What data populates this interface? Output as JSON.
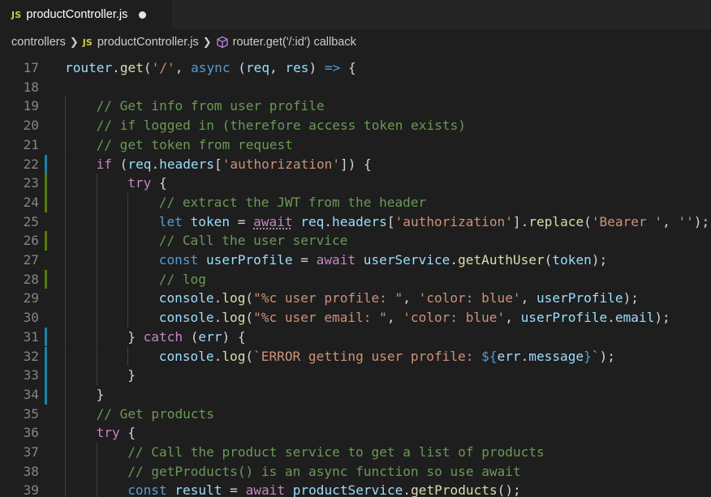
{
  "tab": {
    "badge": "JS",
    "label": "productController.js",
    "dirty": true
  },
  "breadcrumb": {
    "items": [
      {
        "label": "controllers"
      },
      {
        "label": "productController.js",
        "badge": "JS"
      },
      {
        "label": "router.get('/:id') callback",
        "icon": "symbol-method-icon"
      }
    ],
    "separator": "chevron-right-icon"
  },
  "colors": {
    "keyword_blue": "#569cd6",
    "control_purple": "#c586c0",
    "function_yellow": "#dcdcaa",
    "variable_blue": "#9cdcfe",
    "string_orange": "#ce9178",
    "comment_green": "#6a9955",
    "default_text": "#d4d4d4",
    "gutter_added": "#587c0c",
    "gutter_modified": "#1b81a8",
    "js_badge": "#cbcb41"
  },
  "code": {
    "lines": [
      {
        "n": 17,
        "indent": 0,
        "mark": "",
        "tokens": [
          [
            "router",
            "var"
          ],
          [
            ".",
            ""
          ],
          [
            "get",
            "fn"
          ],
          [
            "(",
            ""
          ],
          [
            "'/'",
            "str"
          ],
          [
            ", ",
            ""
          ],
          [
            "async",
            "kw"
          ],
          [
            " (",
            ""
          ],
          [
            "req",
            "var"
          ],
          [
            ", ",
            ""
          ],
          [
            "res",
            "var"
          ],
          [
            ") ",
            ""
          ],
          [
            "=>",
            "kw"
          ],
          [
            " {",
            ""
          ]
        ]
      },
      {
        "n": 18,
        "indent": 0,
        "mark": "",
        "tokens": []
      },
      {
        "n": 19,
        "indent": 1,
        "mark": "",
        "tokens": [
          [
            "// Get info from user profile",
            "comment"
          ]
        ]
      },
      {
        "n": 20,
        "indent": 1,
        "mark": "",
        "tokens": [
          [
            "// if logged in (therefore access token exists)",
            "comment"
          ]
        ]
      },
      {
        "n": 21,
        "indent": 1,
        "mark": "",
        "tokens": [
          [
            "// get token from request",
            "comment"
          ]
        ]
      },
      {
        "n": 22,
        "indent": 1,
        "mark": "blue",
        "tokens": [
          [
            "if",
            "ctrl"
          ],
          [
            " (",
            ""
          ],
          [
            "req",
            "var"
          ],
          [
            ".",
            ""
          ],
          [
            "headers",
            "var"
          ],
          [
            "[",
            ""
          ],
          [
            "'authorization'",
            "str"
          ],
          [
            "]) {",
            ""
          ]
        ]
      },
      {
        "n": 23,
        "indent": 2,
        "mark": "green",
        "tokens": [
          [
            "try",
            "ctrl"
          ],
          [
            " {",
            ""
          ]
        ]
      },
      {
        "n": 24,
        "indent": 3,
        "mark": "green",
        "tokens": [
          [
            "// extract the JWT from the header",
            "comment"
          ]
        ]
      },
      {
        "n": 25,
        "indent": 3,
        "mark": "",
        "tokens": [
          [
            "let",
            "kw"
          ],
          [
            " ",
            ""
          ],
          [
            "token",
            "var"
          ],
          [
            " = ",
            ""
          ],
          [
            "await",
            "ctrl squiggle"
          ],
          [
            " ",
            ""
          ],
          [
            "req",
            "var"
          ],
          [
            ".",
            ""
          ],
          [
            "headers",
            "var"
          ],
          [
            "[",
            ""
          ],
          [
            "'authorization'",
            "str"
          ],
          [
            "].",
            ""
          ],
          [
            "replace",
            "fn"
          ],
          [
            "(",
            ""
          ],
          [
            "'Bearer '",
            "str"
          ],
          [
            ", ",
            ""
          ],
          [
            "''",
            "str"
          ],
          [
            ");",
            ""
          ]
        ]
      },
      {
        "n": 26,
        "indent": 3,
        "mark": "green",
        "tokens": [
          [
            "// Call the user service",
            "comment"
          ]
        ]
      },
      {
        "n": 27,
        "indent": 3,
        "mark": "",
        "tokens": [
          [
            "const",
            "kw"
          ],
          [
            " ",
            ""
          ],
          [
            "userProfile",
            "var"
          ],
          [
            " = ",
            ""
          ],
          [
            "await",
            "ctrl"
          ],
          [
            " ",
            ""
          ],
          [
            "userService",
            "var"
          ],
          [
            ".",
            ""
          ],
          [
            "getAuthUser",
            "fn"
          ],
          [
            "(",
            ""
          ],
          [
            "token",
            "var"
          ],
          [
            ");",
            ""
          ]
        ]
      },
      {
        "n": 28,
        "indent": 3,
        "mark": "green",
        "tokens": [
          [
            "// log",
            "comment"
          ]
        ]
      },
      {
        "n": 29,
        "indent": 3,
        "mark": "",
        "tokens": [
          [
            "console",
            "var"
          ],
          [
            ".",
            ""
          ],
          [
            "log",
            "fn"
          ],
          [
            "(",
            ""
          ],
          [
            "\"%c user profile: \"",
            "str"
          ],
          [
            ", ",
            ""
          ],
          [
            "'color: blue'",
            "str"
          ],
          [
            ", ",
            ""
          ],
          [
            "userProfile",
            "var"
          ],
          [
            ");",
            ""
          ]
        ]
      },
      {
        "n": 30,
        "indent": 3,
        "mark": "",
        "tokens": [
          [
            "console",
            "var"
          ],
          [
            ".",
            ""
          ],
          [
            "log",
            "fn"
          ],
          [
            "(",
            ""
          ],
          [
            "\"%c user email: \"",
            "str"
          ],
          [
            ", ",
            ""
          ],
          [
            "'color: blue'",
            "str"
          ],
          [
            ", ",
            ""
          ],
          [
            "userProfile",
            "var"
          ],
          [
            ".",
            ""
          ],
          [
            "email",
            "var"
          ],
          [
            ");",
            ""
          ]
        ]
      },
      {
        "n": 31,
        "indent": 2,
        "mark": "blue",
        "tokens": [
          [
            "} ",
            ""
          ],
          [
            "catch",
            "ctrl"
          ],
          [
            " (",
            ""
          ],
          [
            "err",
            "var"
          ],
          [
            ") {",
            ""
          ]
        ]
      },
      {
        "n": 32,
        "indent": 3,
        "mark": "blue",
        "tokens": [
          [
            "console",
            "var"
          ],
          [
            ".",
            ""
          ],
          [
            "log",
            "fn"
          ],
          [
            "(",
            ""
          ],
          [
            "`ERROR getting user profile: ",
            "str"
          ],
          [
            "${",
            "kw"
          ],
          [
            "err",
            "var"
          ],
          [
            ".",
            ""
          ],
          [
            "message",
            "var"
          ],
          [
            "}",
            "kw"
          ],
          [
            "`",
            "str"
          ],
          [
            ");",
            ""
          ]
        ]
      },
      {
        "n": 33,
        "indent": 2,
        "mark": "blue",
        "tokens": [
          [
            "}",
            ""
          ]
        ]
      },
      {
        "n": 34,
        "indent": 1,
        "mark": "blue",
        "tokens": [
          [
            "}",
            ""
          ]
        ]
      },
      {
        "n": 35,
        "indent": 1,
        "mark": "",
        "tokens": [
          [
            "// Get products",
            "comment"
          ]
        ]
      },
      {
        "n": 36,
        "indent": 1,
        "mark": "",
        "tokens": [
          [
            "try",
            "ctrl"
          ],
          [
            " {",
            ""
          ]
        ]
      },
      {
        "n": 37,
        "indent": 2,
        "mark": "",
        "tokens": [
          [
            "// Call the product service to get a list of products",
            "comment"
          ]
        ]
      },
      {
        "n": 38,
        "indent": 2,
        "mark": "",
        "tokens": [
          [
            "// getProducts() is an async function so use await",
            "comment"
          ]
        ]
      },
      {
        "n": 39,
        "indent": 2,
        "mark": "",
        "tokens": [
          [
            "const",
            "kw"
          ],
          [
            " ",
            ""
          ],
          [
            "result",
            "var"
          ],
          [
            " = ",
            ""
          ],
          [
            "await",
            "ctrl"
          ],
          [
            " ",
            ""
          ],
          [
            "productService",
            "var"
          ],
          [
            ".",
            ""
          ],
          [
            "getProducts",
            "fn"
          ],
          [
            "();",
            ""
          ]
        ]
      }
    ]
  }
}
